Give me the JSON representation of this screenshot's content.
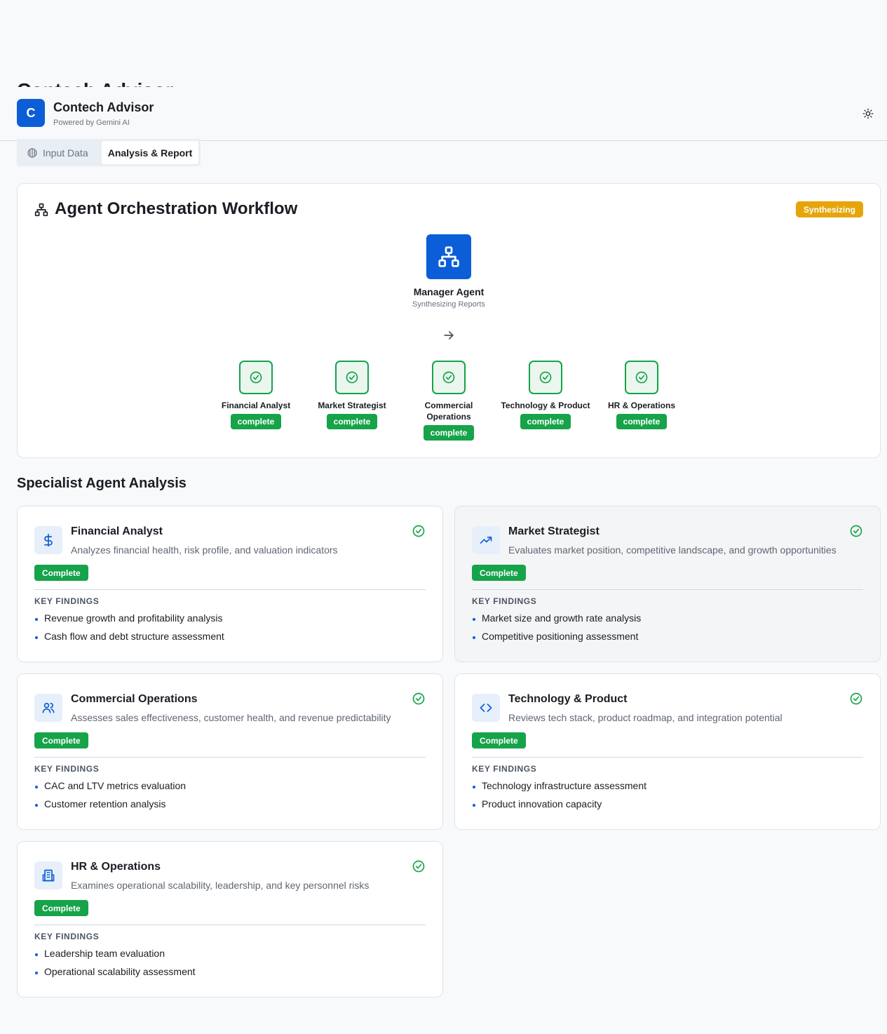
{
  "app": {
    "ghost_title": "Contech Advisor",
    "logo_letter": "C",
    "title": "Contech Advisor",
    "subtitle": "Powered by Gemini AI",
    "theme_icon": "sun-icon"
  },
  "tabs": [
    {
      "label": "Input Data",
      "icon": "brain-icon",
      "active": false
    },
    {
      "label": "Analysis & Report",
      "active": true
    }
  ],
  "workflow": {
    "title": "Agent Orchestration Workflow",
    "status": "Synthesizing",
    "manager": {
      "name": "Manager Agent",
      "status": "Synthesizing Reports"
    },
    "agents": [
      {
        "label": "Financial Analyst",
        "status": "complete"
      },
      {
        "label": "Market Strategist",
        "status": "complete"
      },
      {
        "label": "Commercial Operations",
        "status": "complete"
      },
      {
        "label": "Technology & Product",
        "status": "complete"
      },
      {
        "label": "HR & Operations",
        "status": "complete"
      }
    ]
  },
  "specialists": {
    "title": "Specialist Agent Analysis",
    "key_findings_label": "KEY FINDINGS",
    "cards": [
      {
        "icon": "dollar-icon",
        "title": "Financial Analyst",
        "description": "Analyzes financial health, risk profile, and valuation indicators",
        "status": "Complete",
        "findings": [
          "Revenue growth and profitability analysis",
          "Cash flow and debt structure assessment"
        ]
      },
      {
        "icon": "trending-up-icon",
        "title": "Market Strategist",
        "description": "Evaluates market position, competitive landscape, and growth opportunities",
        "status": "Complete",
        "findings": [
          "Market size and growth rate analysis",
          "Competitive positioning assessment"
        ]
      },
      {
        "icon": "users-icon",
        "title": "Commercial Operations",
        "description": "Assesses sales effectiveness, customer health, and revenue predictability",
        "status": "Complete",
        "findings": [
          "CAC and LTV metrics evaluation",
          "Customer retention analysis"
        ]
      },
      {
        "icon": "code-icon",
        "title": "Technology & Product",
        "description": "Reviews tech stack, product roadmap, and integration potential",
        "status": "Complete",
        "findings": [
          "Technology infrastructure assessment",
          "Product innovation capacity"
        ]
      },
      {
        "icon": "building-icon",
        "title": "HR & Operations",
        "description": "Examines operational scalability, leadership, and key personnel risks",
        "status": "Complete",
        "findings": [
          "Leadership team evaluation",
          "Operational scalability assessment"
        ]
      }
    ]
  },
  "colors": {
    "primary": "#0b5ed7",
    "success": "#16a34a",
    "warning": "#e5a50a"
  }
}
